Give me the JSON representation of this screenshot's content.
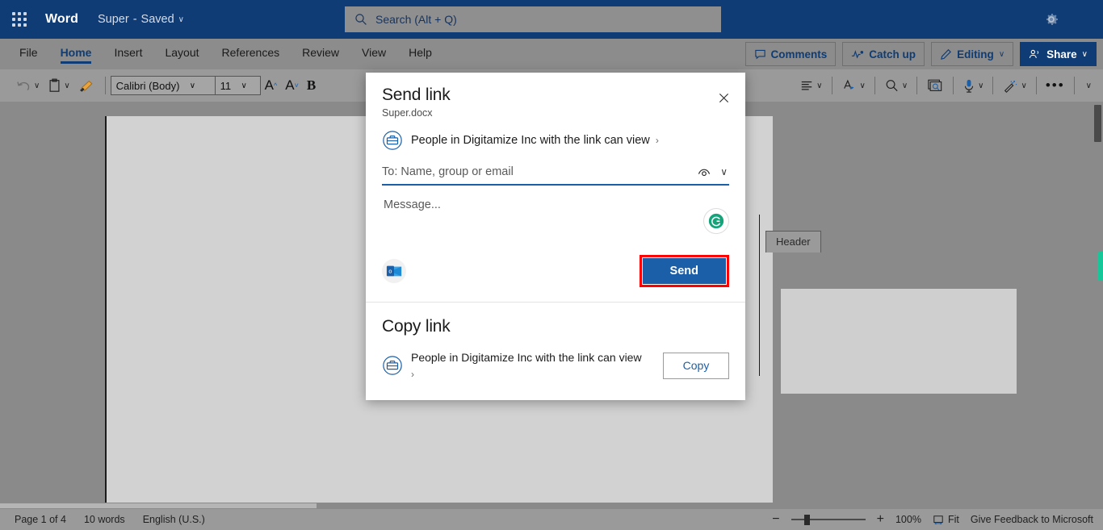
{
  "titlebar": {
    "waffle_label": "app-launcher",
    "app_name": "Word",
    "doc_name": "Super",
    "doc_sep": "-",
    "doc_state": "Saved",
    "chevron": "∨",
    "gear_icon": "gear-icon"
  },
  "search": {
    "placeholder": "Search (Alt + Q)",
    "icon": "search-icon"
  },
  "ribbon": {
    "tabs": [
      {
        "label": "File",
        "active": false
      },
      {
        "label": "Home",
        "active": true
      },
      {
        "label": "Insert",
        "active": false
      },
      {
        "label": "Layout",
        "active": false
      },
      {
        "label": "References",
        "active": false
      },
      {
        "label": "Review",
        "active": false
      },
      {
        "label": "View",
        "active": false
      },
      {
        "label": "Help",
        "active": false
      }
    ]
  },
  "top_actions": {
    "comments": "Comments",
    "catch_up": "Catch up",
    "editing": "Editing",
    "share": "Share",
    "chevron": "∨"
  },
  "toolbar": {
    "undo_icon": "undo-icon",
    "paste_icon": "clipboard-icon",
    "format_painter_icon": "format-painter-icon",
    "font_name": "Calibri (Body)",
    "font_size": "11",
    "grow_font": "A",
    "shrink_font": "A",
    "bold": "B",
    "align_icon": "align-icon",
    "text_highlight_icon": "text-highlight-icon",
    "find_icon": "find-icon",
    "immersive_reader_icon": "immersive-reader-icon",
    "dictate_icon": "microphone-icon",
    "editor_icon": "editor-wand-icon",
    "more_commands": "•••",
    "collapse_chevron": "∨",
    "dropdown_chevron": "∨"
  },
  "document": {
    "header_tab_label": "Header"
  },
  "dialog": {
    "title": "Send link",
    "subtitle": "Super.docx",
    "close_icon": "close-icon",
    "permission": {
      "icon": "briefcase-icon",
      "text": "People in Digitamize Inc with the link can view",
      "arrow": "›"
    },
    "to_field": {
      "placeholder": "To: Name, group or email",
      "value": "",
      "eye_icon": "eye-contacts-icon",
      "chevron": "∨"
    },
    "message": {
      "placeholder": "Message...",
      "value": ""
    },
    "grammarly_icon": "grammarly-icon",
    "outlook_icon": "outlook-icon",
    "send_label": "Send",
    "copy_section": {
      "title": "Copy link",
      "icon": "briefcase-icon",
      "text": "People in Digitamize Inc with the link can view",
      "arrow": "›",
      "copy_label": "Copy"
    }
  },
  "statusbar": {
    "page": "Page 1 of 4",
    "words": "10 words",
    "language": "English (U.S.)",
    "zoom_minus": "−",
    "zoom_plus": "+",
    "zoom_level": "100%",
    "fit": "Fit",
    "fit_icon": "fit-width-icon",
    "feedback": "Give Feedback to Microsoft"
  },
  "colors": {
    "brand_blue": "#0f3c74",
    "accent_blue": "#1b5fa8",
    "highlight_red": "#ff0000",
    "grammarly_green": "#15a47a",
    "green_tab": "#16c79a"
  }
}
